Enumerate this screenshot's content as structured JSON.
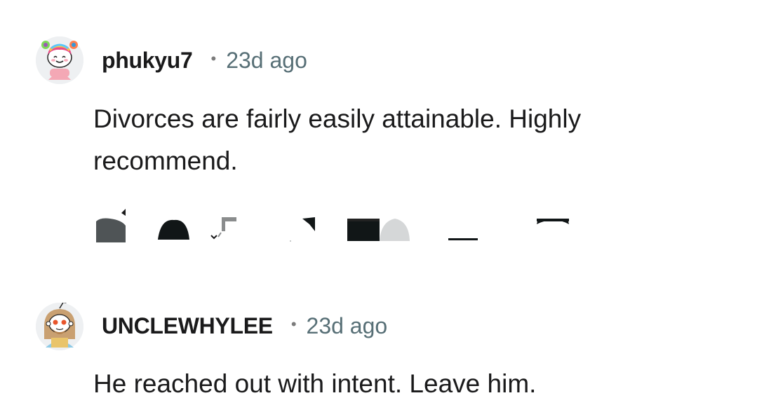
{
  "comments": [
    {
      "username": "phukyu7",
      "separator": "•",
      "age": "23d ago",
      "avatar_icon": "snoo-avatar-rainbow-hair-icon",
      "text": "Divorces are fairly easily attainable. Highly recommend."
    },
    {
      "username": "UNCLEWHYLEE",
      "separator": "•",
      "age": "23d ago",
      "avatar_icon": "snoo-avatar-bearded-icon",
      "text": "He reached out with intent. Leave him."
    }
  ],
  "actions": {
    "icons": [
      "more-options-icon",
      "reply-icon",
      "award-icon",
      "share-icon",
      "upvote-icon",
      "downvote-icon"
    ]
  },
  "colors": {
    "username": "#1a1a1b",
    "meta": "#576f76",
    "text": "#1a1a1b"
  }
}
